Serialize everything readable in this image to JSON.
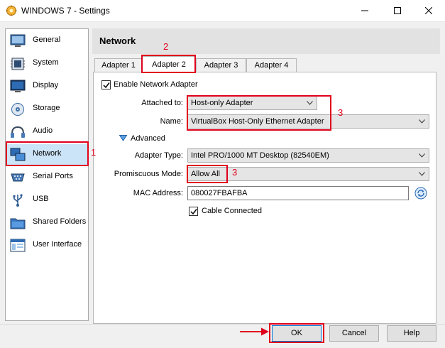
{
  "window": {
    "title": "WINDOWS 7 - Settings"
  },
  "sidebar": {
    "items": [
      {
        "label": "General",
        "icon": "general-icon"
      },
      {
        "label": "System",
        "icon": "system-icon"
      },
      {
        "label": "Display",
        "icon": "display-icon"
      },
      {
        "label": "Storage",
        "icon": "storage-icon"
      },
      {
        "label": "Audio",
        "icon": "audio-icon"
      },
      {
        "label": "Network",
        "icon": "network-icon",
        "selected": true
      },
      {
        "label": "Serial Ports",
        "icon": "serial-ports-icon"
      },
      {
        "label": "USB",
        "icon": "usb-icon"
      },
      {
        "label": "Shared Folders",
        "icon": "shared-folders-icon"
      },
      {
        "label": "User Interface",
        "icon": "user-interface-icon"
      }
    ]
  },
  "main": {
    "title": "Network",
    "tabs": [
      {
        "label": "Adapter 1"
      },
      {
        "label": "Adapter 2",
        "active": true
      },
      {
        "label": "Adapter 3"
      },
      {
        "label": "Adapter 4"
      }
    ],
    "enable_adapter": {
      "label": "Enable Network Adapter",
      "checked": true
    },
    "attached_to": {
      "label": "Attached to:",
      "value": "Host-only Adapter"
    },
    "name": {
      "label": "Name:",
      "value": "VirtualBox Host-Only Ethernet Adapter"
    },
    "advanced": {
      "label": "Advanced"
    },
    "adapter_type": {
      "label": "Adapter Type:",
      "value": "Intel PRO/1000 MT Desktop (82540EM)"
    },
    "promiscuous_mode": {
      "label": "Promiscuous Mode:",
      "value": "Allow All"
    },
    "mac_address": {
      "label": "MAC Address:",
      "value": "080027FBAFBA"
    },
    "cable_connected": {
      "label": "Cable Connected",
      "checked": true
    }
  },
  "annotations": {
    "a1": "1",
    "a2": "2",
    "a3": "3",
    "a4": "3"
  },
  "buttons": {
    "ok": "OK",
    "cancel": "Cancel",
    "help": "Help"
  },
  "colors": {
    "annotation": "#e0001b",
    "selection": "#cce4f7",
    "accent": "#0078d7"
  }
}
